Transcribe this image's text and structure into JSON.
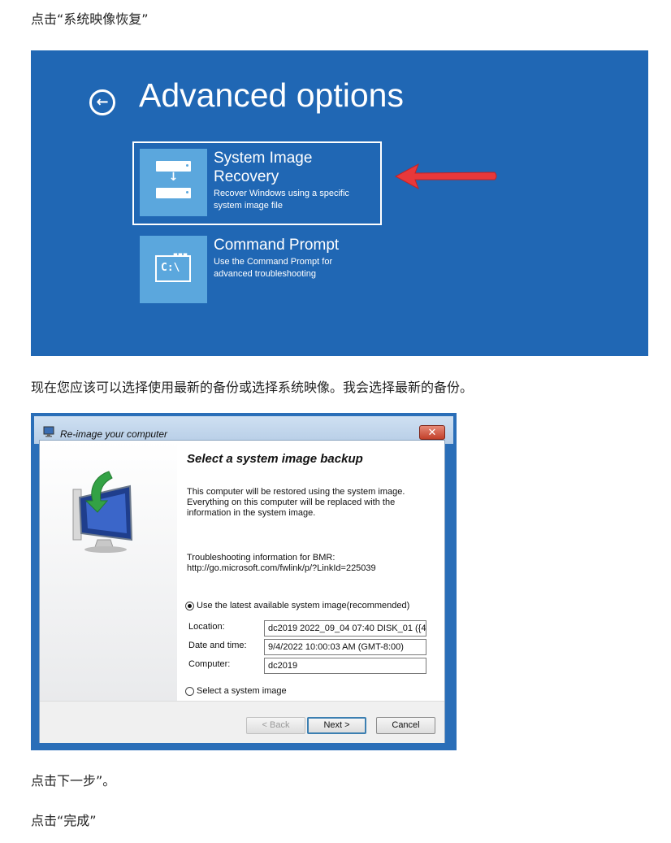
{
  "article": {
    "step1": "点击“系统映像恢复”",
    "step2": "现在您应该可以选择使用最新的备份或选择系统映像。我会选择最新的备份。",
    "step3": "点击下一步”。",
    "step4": "点击“完成”"
  },
  "advanced_options": {
    "title": "Advanced options",
    "background_color": "#2067b4",
    "tiles": [
      {
        "title_line1": "System Image",
        "title_line2": "Recovery",
        "desc_line1": "Recover Windows using a specific",
        "desc_line2": "system image file",
        "icon": "system-image-icon"
      },
      {
        "title_line1": "Command Prompt",
        "desc_line1": "Use the Command Prompt for",
        "desc_line2": "advanced troubleshooting",
        "icon": "command-prompt-icon",
        "icon_text": "C:\\"
      }
    ],
    "annotation_arrow_color": "#e8383a"
  },
  "dialog": {
    "window_title": "Re-image your computer",
    "close_glyph": "✕",
    "heading": "Select a system image backup",
    "desc_line1": "This computer will be restored using the system image.",
    "desc_line2": "Everything on this computer will be replaced with the",
    "desc_line3": "information in the system image.",
    "trouble_line1": "Troubleshooting information for BMR:",
    "trouble_line2": "http://go.microsoft.com/fwlink/p/?LinkId=225039",
    "option_latest": "Use the latest available system image(recommended)",
    "option_select": "Select a system image",
    "selected_option": "latest",
    "fields": {
      "location_label": "Location:",
      "location_value": "dc2019 2022_09_04 07:40 DISK_01 ({4",
      "date_label": "Date and time:",
      "date_value": "9/4/2022 10:00:03 AM (GMT-8:00)",
      "computer_label": "Computer:",
      "computer_value": "dc2019"
    },
    "buttons": {
      "back": "< Back",
      "next": "Next >",
      "cancel": "Cancel"
    }
  }
}
